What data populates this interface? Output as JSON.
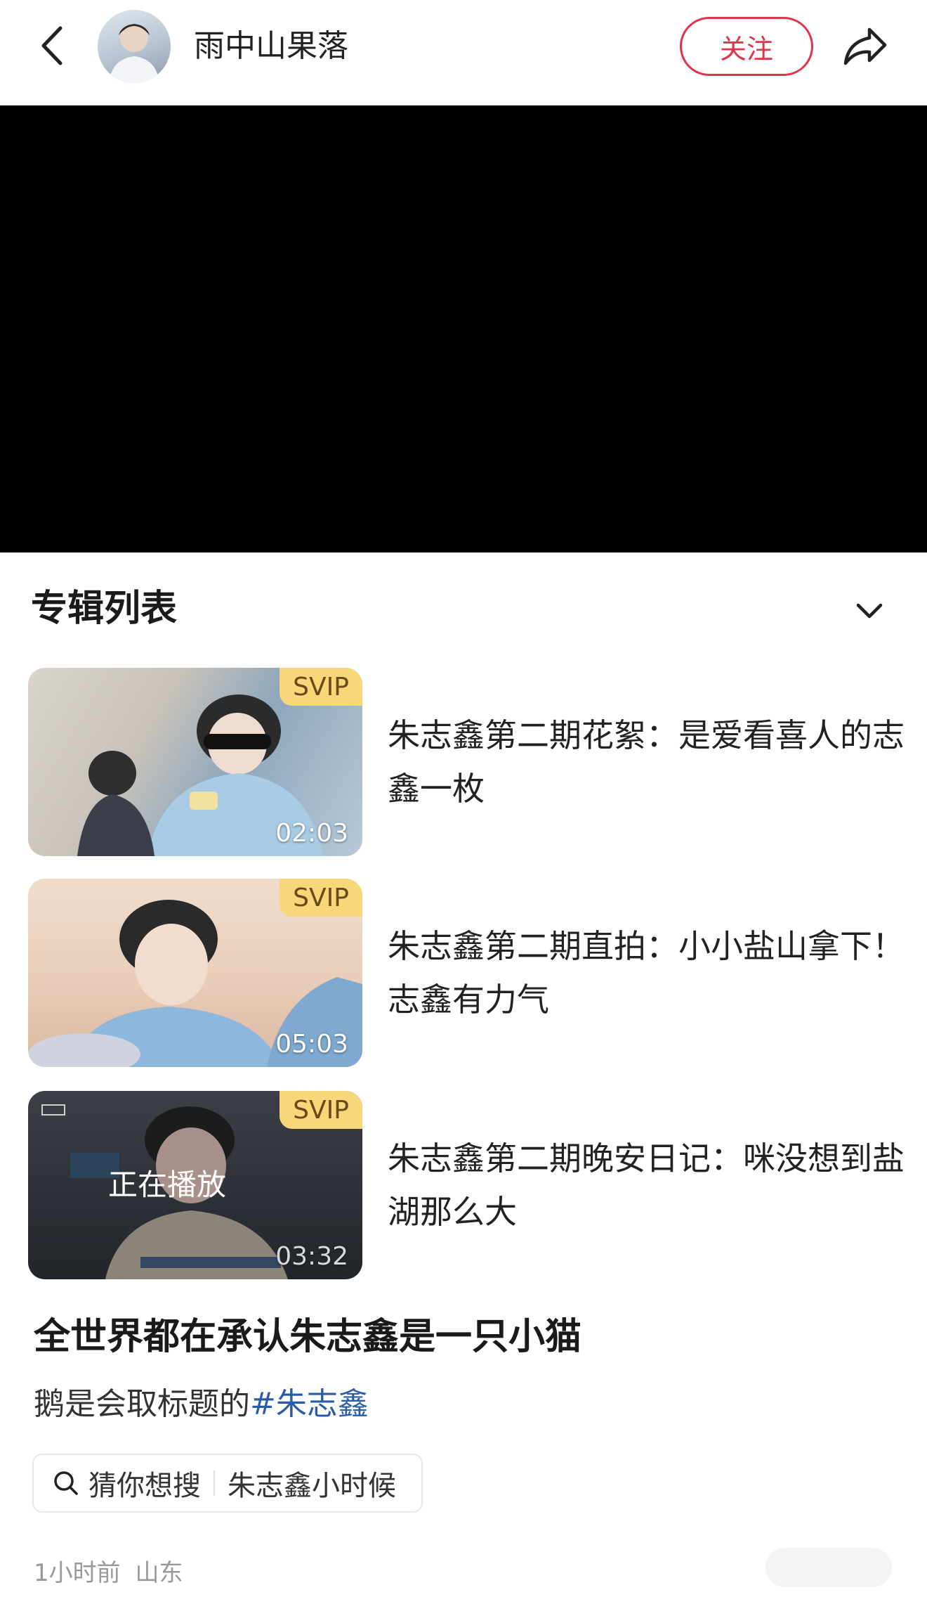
{
  "header": {
    "author_name": "雨中山果落",
    "follow_label": "关注"
  },
  "album": {
    "title": "专辑列表",
    "episodes": [
      {
        "title": "朱志鑫第二期花絮：是爱看喜人的志鑫一枚",
        "badge": "SVIP",
        "duration": "02:03",
        "now_playing": ""
      },
      {
        "title": "朱志鑫第二期直拍：小小盐山拿下！志鑫有力气",
        "badge": "SVIP",
        "duration": "05:03",
        "now_playing": ""
      },
      {
        "title": "朱志鑫第二期晚安日记：咪没想到盐湖那么大",
        "badge": "SVIP",
        "duration": "03:32",
        "now_playing": "正在播放"
      }
    ]
  },
  "post": {
    "title": "全世界都在承认朱志鑫是一只小猫",
    "desc_text": "鹅是会取标题的",
    "hashtag": "#朱志鑫"
  },
  "search": {
    "label": "猜你想搜",
    "term": "朱志鑫小时候"
  },
  "meta": {
    "time": "1小时前",
    "location": "山东"
  },
  "colors": {
    "accent_red": "#e0344a",
    "hashtag_blue": "#2b5ca8",
    "svip_gold": "#f7d77a"
  },
  "icons": [
    "back-icon",
    "share-icon",
    "chevron-down-icon",
    "search-icon"
  ]
}
